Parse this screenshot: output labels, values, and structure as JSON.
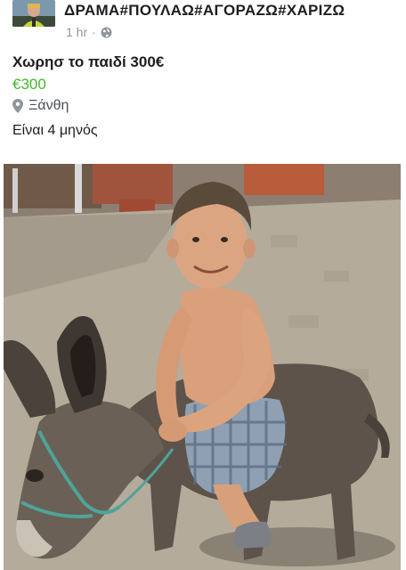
{
  "header": {
    "group_name": "ΔΡΑΜΑ#ΠΟΥΛΑΩ#ΑΓΟΡΑΖΩ#ΧΑΡΙΖΩ",
    "time": "1 hr",
    "separator": "·",
    "privacy_icon": "globe-icon",
    "avatar_icon": "person-avatar"
  },
  "listing": {
    "title": "Χωρησ το παιδί 300€",
    "price": "€300",
    "location_icon": "map-pin-icon",
    "location": "Ξάνθη",
    "description": "Είναι 4 μηνός"
  },
  "photo": {
    "subject": "child-on-donkey-photo"
  },
  "colors": {
    "price_green": "#42b72a",
    "meta_gray": "#90949c",
    "text_dark": "#1c1e21"
  }
}
